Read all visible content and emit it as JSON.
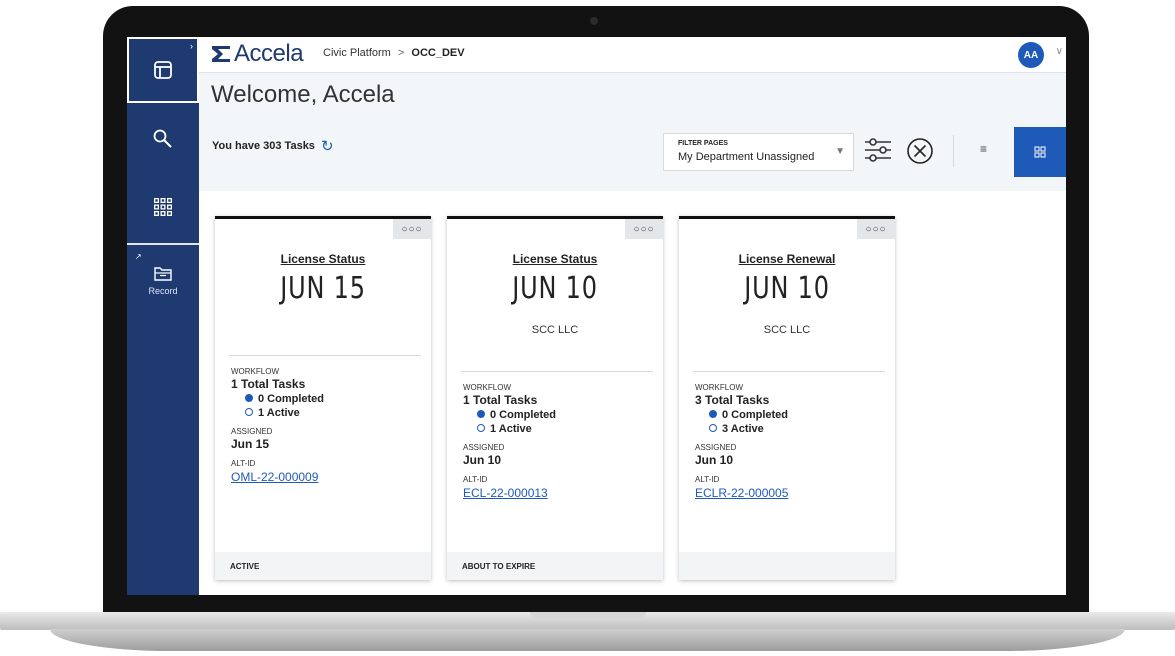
{
  "app": {
    "brand": "Accela",
    "breadcrumb_root": "Civic Platform",
    "breadcrumb_sep": ">",
    "breadcrumb_current": "OCC_DEV",
    "avatar_initials": "AA",
    "accent_color": "#1e5bb8",
    "sidebar_color": "#1e3a70"
  },
  "sidebar": {
    "items": [
      {
        "name": "dashboard",
        "icon": "layout-icon"
      },
      {
        "name": "search",
        "icon": "search-icon"
      },
      {
        "name": "apps",
        "icon": "grid-icon"
      },
      {
        "name": "record",
        "icon": "folder-icon",
        "label": "Record"
      }
    ]
  },
  "dashboard": {
    "welcome": "Welcome, Accela",
    "tasks_text": "You have 303 Tasks",
    "filter_label": "FILTER PAGES",
    "filter_value": "My Department Unassigned"
  },
  "cards": [
    {
      "title": "License Status",
      "date": "JUN 15",
      "subtitle": "",
      "workflow_label": "WORKFLOW",
      "total_tasks": "1 Total Tasks",
      "completed": "0 Completed",
      "active": "1 Active",
      "assigned_label": "ASSIGNED",
      "assigned": "Jun 15",
      "alt_label": "ALT-ID",
      "alt_id": "OML-22-000009",
      "status": "ACTIVE"
    },
    {
      "title": "License Status",
      "date": "JUN 10",
      "subtitle": "SCC LLC",
      "workflow_label": "WORKFLOW",
      "total_tasks": "1 Total Tasks",
      "completed": "0 Completed",
      "active": "1 Active",
      "assigned_label": "ASSIGNED",
      "assigned": "Jun 10",
      "alt_label": "ALT-ID",
      "alt_id": "ECL-22-000013",
      "status": "ABOUT TO EXPIRE"
    },
    {
      "title": "License Renewal",
      "date": "JUN 10",
      "subtitle": "SCC LLC",
      "workflow_label": "WORKFLOW",
      "total_tasks": "3 Total Tasks",
      "completed": "0 Completed",
      "active": "3 Active",
      "assigned_label": "ASSIGNED",
      "assigned": "Jun 10",
      "alt_label": "ALT-ID",
      "alt_id": "ECLR-22-000005",
      "status": ""
    }
  ]
}
